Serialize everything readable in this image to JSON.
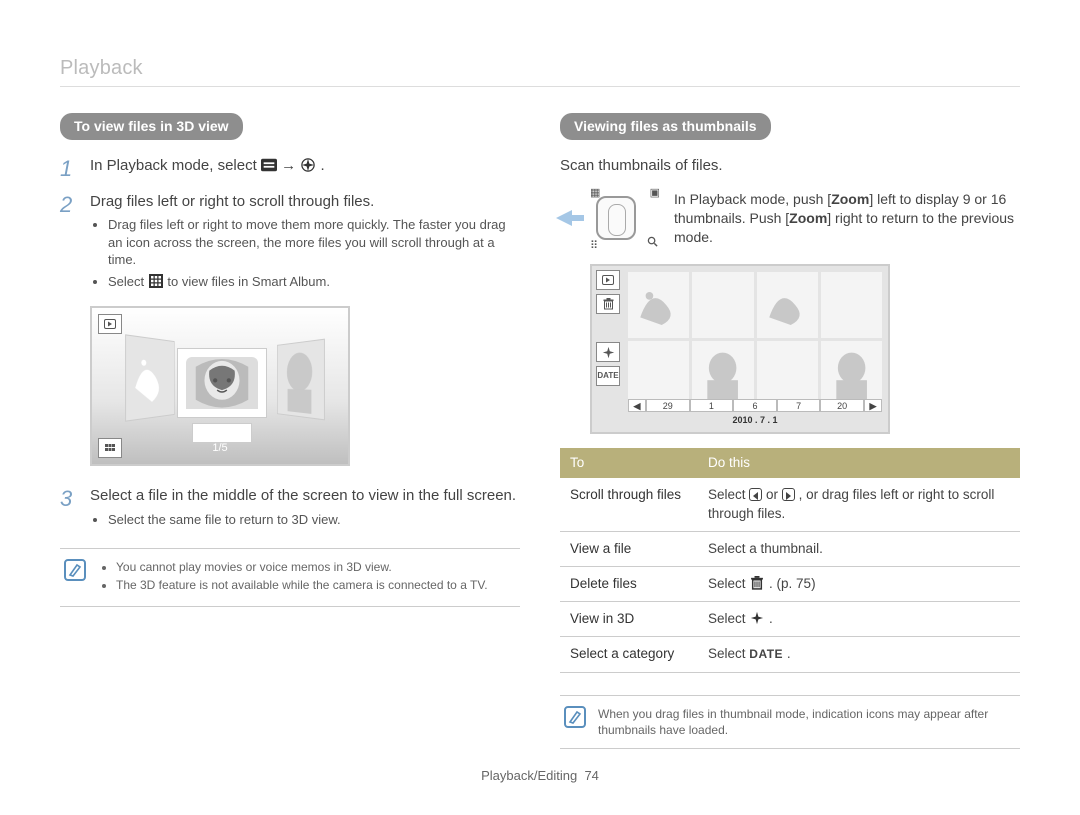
{
  "header": {
    "section": "Playback"
  },
  "left": {
    "pill": "To view files in 3D view",
    "step1": {
      "num": "1",
      "text": "In Playback mode, select",
      "arrow": " → ",
      "end": "."
    },
    "step2": {
      "num": "2",
      "main": "Drag files left or right to scroll through files.",
      "sub1": "Drag files left or right to move them more quickly. The faster you drag an icon across the screen, the more files you will scroll through at a time.",
      "sub2a": "Select ",
      "sub2b": " to view files in Smart Album."
    },
    "screenshot": {
      "counter": "1/5"
    },
    "step3": {
      "num": "3",
      "main": "Select a file in the middle of the screen to view in the full screen.",
      "sub": "Select the same file to return to 3D view."
    },
    "note": {
      "a": "You cannot play movies or voice memos in 3D view.",
      "b": "The 3D feature is not available while the camera is connected to a TV."
    }
  },
  "right": {
    "pill": "Viewing files as thumbnails",
    "sub": "Scan thumbnails of files.",
    "zoom": {
      "a": "In Playback mode, push [",
      "zoom": "Zoom",
      "b": "] left to display 9 or 16 thumbnails. Push [",
      "c": "] right to return to the previous mode."
    },
    "thumbs": {
      "nums": [
        "29",
        "1",
        "6",
        "7",
        "20"
      ],
      "date": "2010 . 7 . 1"
    },
    "thead": {
      "to": "To",
      "do": "Do this"
    },
    "rows": {
      "scroll": {
        "label": "Scroll through files",
        "pre": "Select ",
        "mid": " or ",
        "post": ", or drag files left or right to scroll through files."
      },
      "view": {
        "label": "View a file",
        "do": "Select a thumbnail."
      },
      "delete": {
        "label": "Delete files",
        "pre": "Select ",
        "post": ". (p. 75)"
      },
      "v3d": {
        "label": "View in 3D",
        "pre": "Select ",
        "post": "."
      },
      "cat": {
        "label": "Select a category",
        "pre": "Select ",
        "post": "."
      }
    },
    "note": "When you drag files in thumbnail mode, indication icons may appear after thumbnails have loaded."
  },
  "footer": {
    "label": "Playback/Editing",
    "page": "74"
  }
}
